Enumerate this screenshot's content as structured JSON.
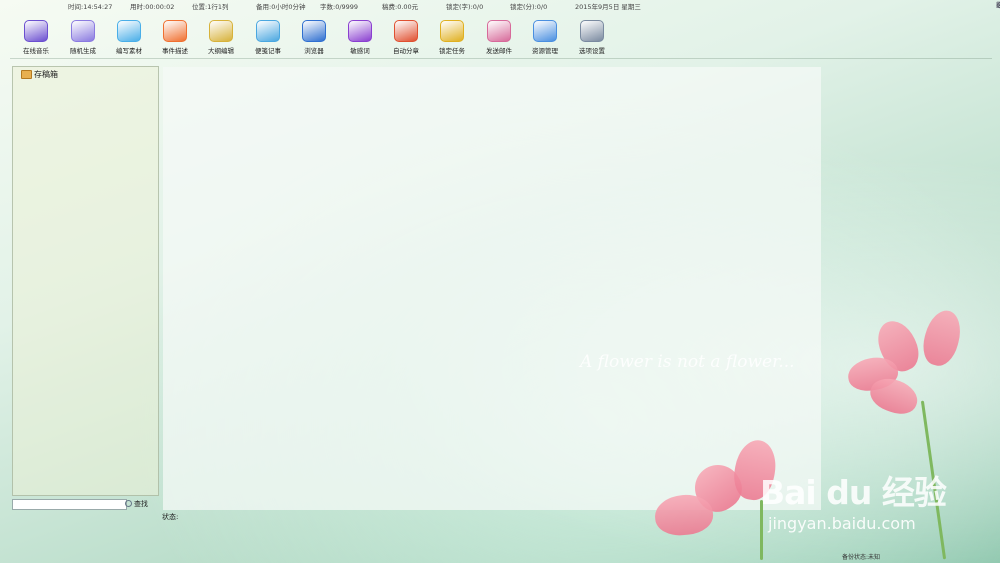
{
  "status_bar": {
    "time": "时间:14:54:27",
    "elapsed": "用时:00:00:02",
    "position": "位置:1行1列",
    "reserve": "备用:0小时0分钟",
    "word_count": "字数:0/9999",
    "fee": "稿费:0.00元",
    "lock_chars": "锁定(字):0/0",
    "lock_minutes": "锁定(分):0/0",
    "date": "2015年9月5日 星期三"
  },
  "toolbar": {
    "items": [
      {
        "label": "在线音乐",
        "icon": "music-disc-icon",
        "color": "#6b4fd0"
      },
      {
        "label": "随机生成",
        "icon": "users-icon",
        "color": "#8a7ae0"
      },
      {
        "label": "编写素材",
        "icon": "folder-icon",
        "color": "#49aee8"
      },
      {
        "label": "事件描述",
        "icon": "windows-icon",
        "color": "#f07030"
      },
      {
        "label": "大纲编辑",
        "icon": "outline-icon",
        "color": "#d7b23a"
      },
      {
        "label": "便笺记事",
        "icon": "notepad-icon",
        "color": "#4aa7e0"
      },
      {
        "label": "浏览器",
        "icon": "globe-icon",
        "color": "#2f6fd0"
      },
      {
        "label": "敏感词",
        "icon": "refresh-icon",
        "color": "#8a3fd0"
      },
      {
        "label": "自动分章",
        "icon": "book-icon",
        "color": "#e05030"
      },
      {
        "label": "锁定任务",
        "icon": "lock-icon",
        "color": "#e0b020"
      },
      {
        "label": "发送邮件",
        "icon": "mail-icon",
        "color": "#d76a9a"
      },
      {
        "label": "资源管理",
        "icon": "computer-icon",
        "color": "#4a8fe0"
      },
      {
        "label": "选项设置",
        "icon": "gear-icon",
        "color": "#7a8aa0"
      }
    ]
  },
  "side_panel": {
    "root_label": "存稿箱",
    "search_button": "查找"
  },
  "editor": {
    "status_label": "状态:",
    "decorative_text": "A flower is not a flower...",
    "bottom_caption": "备份状态:未知"
  },
  "watermark": {
    "logo": "Bai du 经验",
    "url": "jingyan.baidu.com"
  }
}
